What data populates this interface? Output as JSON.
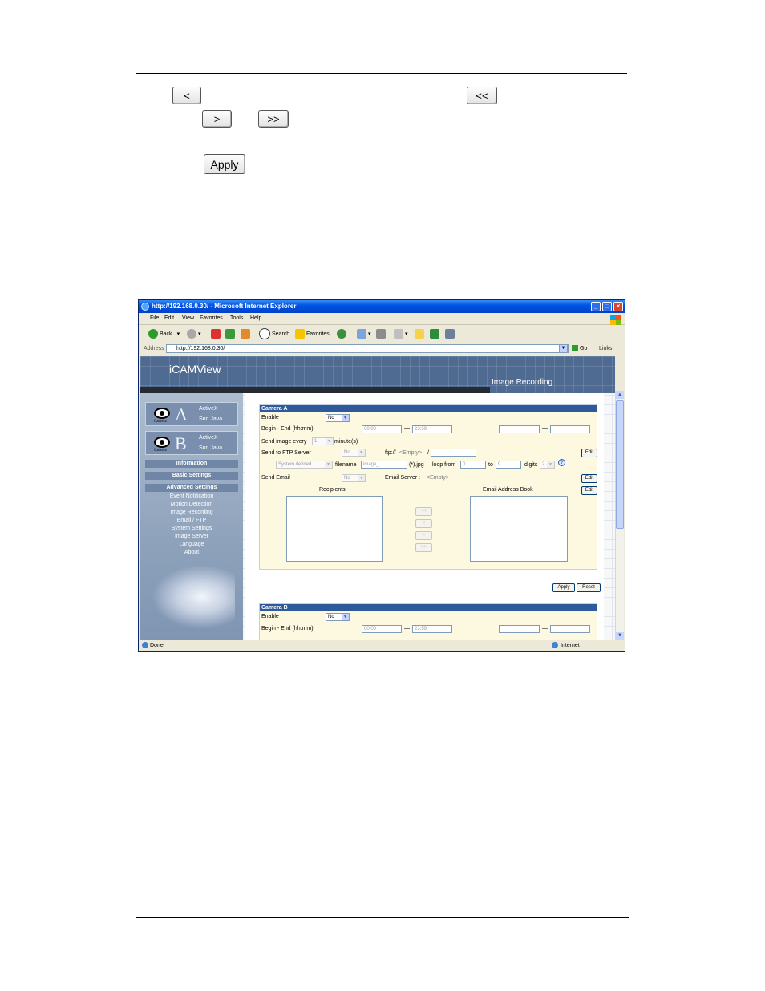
{
  "doc": {
    "buttons": {
      "left": "<",
      "all_left": "<<",
      "right": ">",
      "all_right": ">>",
      "apply": "Apply"
    }
  },
  "browser": {
    "title": "http://192.168.0.30/ - Microsoft Internet Explorer",
    "menu": [
      "File",
      "Edit",
      "View",
      "Favorites",
      "Tools",
      "Help"
    ],
    "toolbar": {
      "back": "Back",
      "search": "Search",
      "favorites": "Favorites"
    },
    "address_label": "Address",
    "address": "http://192.168.0.30/",
    "go": "Go",
    "links": "Links",
    "status": "Done",
    "zone": "Internet"
  },
  "app": {
    "brand": "iCAMView",
    "section": "Image Recording",
    "cam_word": "Camera",
    "cam_a": {
      "letter": "A",
      "activex": "ActiveX",
      "java": "Sun Java"
    },
    "cam_b": {
      "letter": "B",
      "activex": "ActiveX",
      "java": "Sun Java"
    },
    "nav": {
      "information": "Information",
      "basic": "Basic Settings",
      "advanced": "Advanced Settings",
      "items": [
        "Event Notification",
        "Motion Detection",
        "Image Recording",
        "Email / FTP",
        "System Settings",
        "Image Server",
        "Language",
        "About"
      ]
    }
  },
  "form": {
    "camera_a": {
      "title": "Camera A",
      "enable_label": "Enable",
      "enable_value": "No",
      "begin_end_label": "Begin - End (hh:mm)",
      "begin": "00:00",
      "end": "23:59",
      "sep": "—",
      "send_every_label": "Send image every",
      "send_every_value": "1",
      "minutes_label": "minute(s)",
      "ftp_label": "Send to FTP Server",
      "ftp_value": "No",
      "ftp_prefix": "ftp://",
      "ftp_empty": "<Empty>",
      "ftp_slash": "/",
      "edit": "Edit",
      "filename_mode": "System defined",
      "filename_label": "filename",
      "filename_value": "image_",
      "filename_ext": "(*).jpg",
      "loop_from_label": "loop from",
      "loop_from": "0",
      "to_label": "to",
      "loop_to": "9",
      "digits_label": "digits",
      "digits_value": "2",
      "help": "?",
      "email_label": "Send Email",
      "email_value": "No",
      "email_server_label": "Email Server :",
      "email_server_value": "<Empty>",
      "recipients": "Recipients",
      "address_book": "Email Address Book",
      "move_all_left": "<<",
      "move_left": "<",
      "move_right": ">",
      "move_all_right": ">>"
    },
    "apply": "Apply",
    "reset": "Reset",
    "camera_b": {
      "title": "Camera B",
      "enable_label": "Enable",
      "enable_value": "No",
      "begin_end_label": "Begin - End (hh:mm)",
      "begin": "00:00",
      "end": "23:59",
      "sep": "—"
    }
  }
}
